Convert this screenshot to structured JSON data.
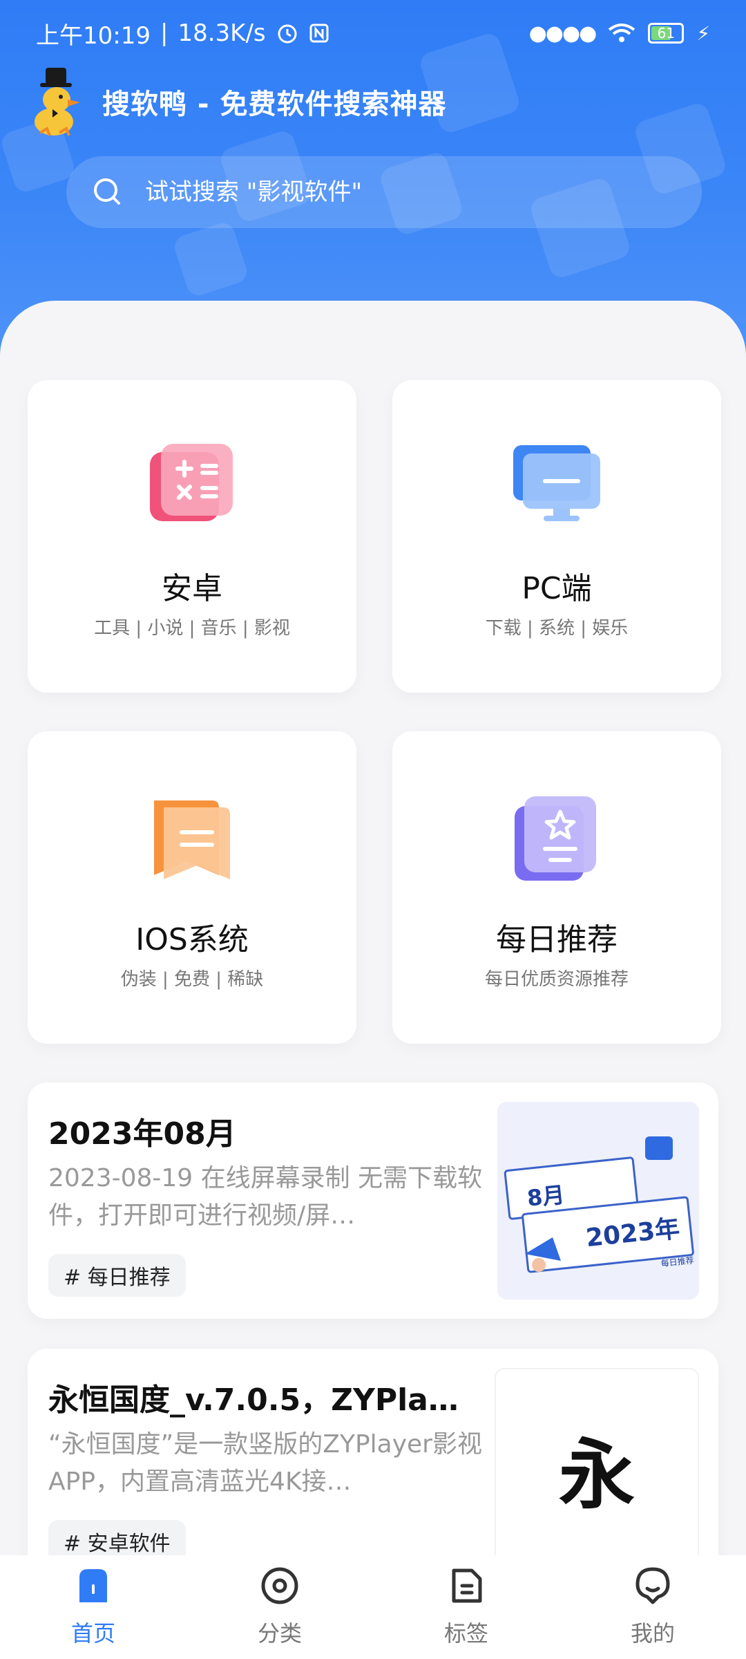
{
  "status_bar": {
    "time": "上午10:19",
    "speed": "18.3K/s",
    "battery": "61"
  },
  "brand": {
    "title": "搜软鸭 - 免费软件搜索神器"
  },
  "search": {
    "placeholder": "试试搜索 \"影视软件\""
  },
  "categories": [
    {
      "name": "安卓",
      "sub": "工具 | 小说 | 音乐 | 影视",
      "icon": "calculator-icon",
      "color": "#f0527a"
    },
    {
      "name": "PC端",
      "sub": "下载 | 系统 | 娱乐",
      "icon": "monitor-icon",
      "color": "#3f86f5"
    },
    {
      "name": "IOS系统",
      "sub": "伪装 | 免费 | 稀缺",
      "icon": "bookmark-icon",
      "color": "#f7933d"
    },
    {
      "name": "每日推荐",
      "sub": "每日优质资源推荐",
      "icon": "star-document-icon",
      "color": "#7a6cf0"
    }
  ],
  "articles": [
    {
      "title": "2023年08月",
      "desc": "2023-08-19 在线屏幕录制 无需下载软件，打开即可进行视频/屏…",
      "tag": "#  每日推荐",
      "thumb": {
        "line1": "8月",
        "line2": "2023年",
        "line3": "每日推荐"
      }
    },
    {
      "title": "永恒国度_v.7.0.5，ZYPla…",
      "desc": "“永恒国度”是一款竖版的ZYPlayer影视APP，内置高清蓝光4K接…",
      "tag": "#  安卓软件",
      "thumb": {
        "char": "永"
      }
    }
  ],
  "tabs": [
    {
      "label": "首页",
      "icon": "home-icon",
      "active": true
    },
    {
      "label": "分类",
      "icon": "category-icon",
      "active": false
    },
    {
      "label": "标签",
      "icon": "tag-icon",
      "active": false
    },
    {
      "label": "我的",
      "icon": "profile-icon",
      "active": false
    }
  ],
  "colors": {
    "primary": "#2f7cf6",
    "inactive": "#777777"
  }
}
